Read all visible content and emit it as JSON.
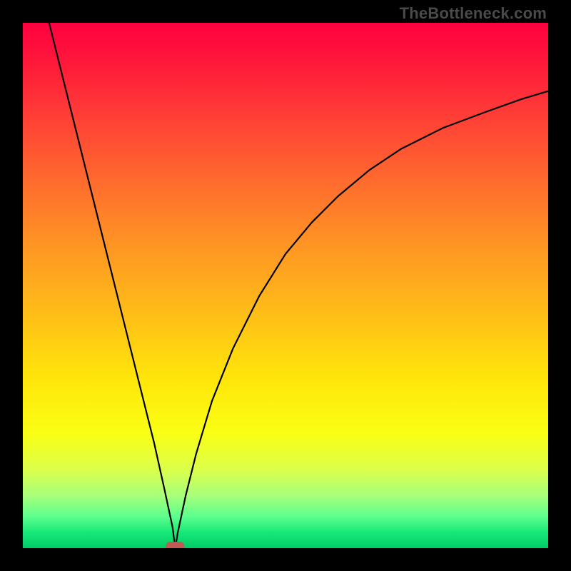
{
  "watermark": "TheBottleneck.com",
  "chart_data": {
    "type": "line",
    "title": "",
    "xlabel": "",
    "ylabel": "",
    "xlim": [
      0,
      100
    ],
    "ylim": [
      0,
      100
    ],
    "grid": false,
    "background_gradient": {
      "stops": [
        {
          "pos": 0,
          "color": "#ff0040"
        },
        {
          "pos": 50,
          "color": "#ffbc18"
        },
        {
          "pos": 80,
          "color": "#faff14"
        },
        {
          "pos": 100,
          "color": "#00cc66"
        }
      ]
    },
    "marker": {
      "x": 29,
      "y": 0,
      "color": "#c05a55",
      "shape": "rounded-rect"
    },
    "series": [
      {
        "name": "curve",
        "color": "#000000",
        "x": [
          5,
          7,
          10,
          13,
          16,
          19,
          22,
          25,
          27,
          28.5,
          29,
          29.5,
          31,
          33,
          36,
          40,
          45,
          50,
          55,
          60,
          66,
          72,
          80,
          88,
          95,
          100
        ],
        "values": [
          100,
          92,
          80,
          68,
          56,
          44,
          32,
          20,
          11,
          4,
          0,
          3,
          10,
          18,
          28,
          38,
          48,
          56,
          62,
          67,
          72,
          76,
          80,
          83,
          85.5,
          87
        ]
      }
    ]
  }
}
